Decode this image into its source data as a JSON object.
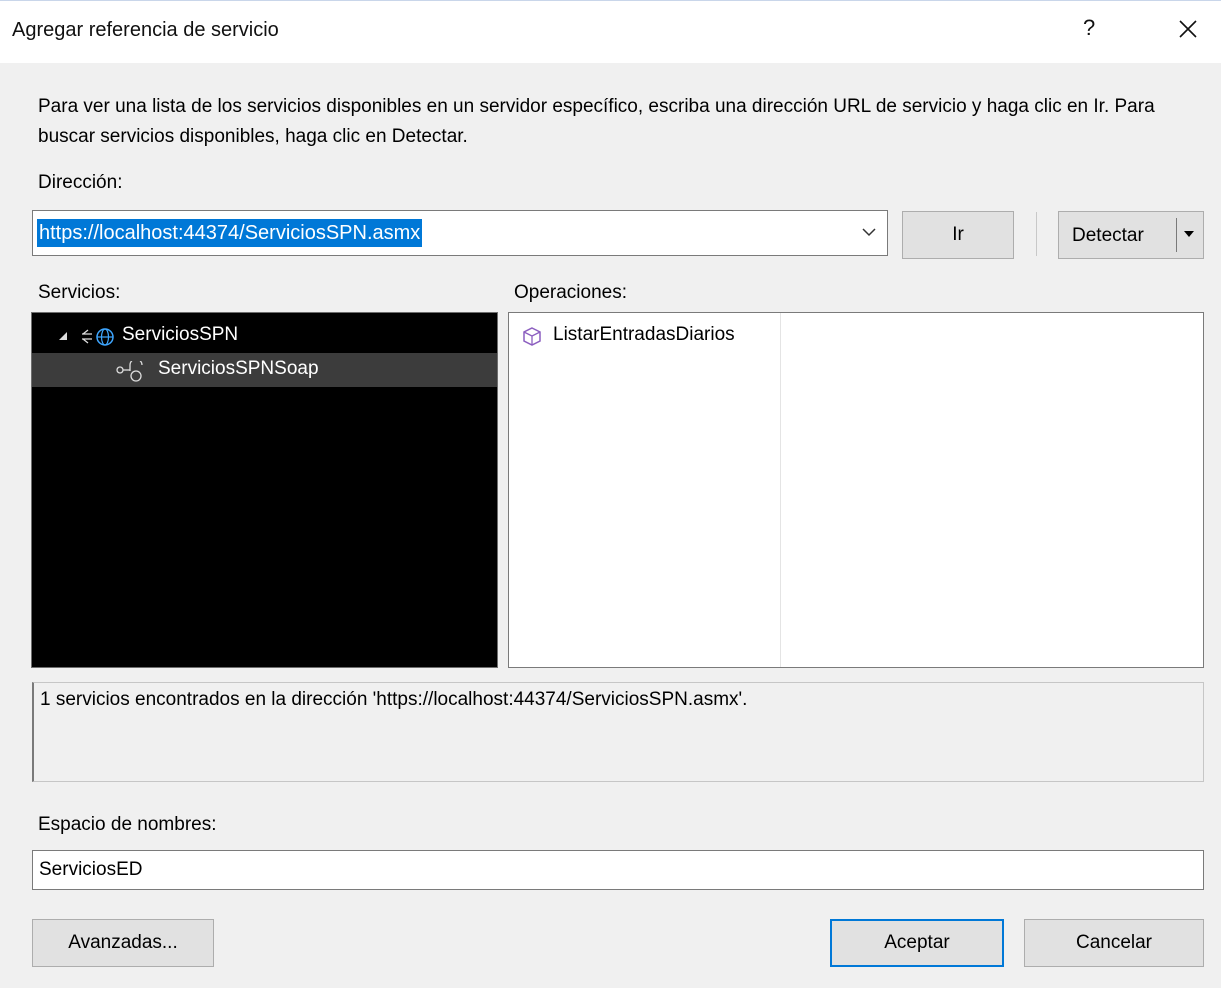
{
  "dialog": {
    "title": "Agregar referencia de servicio",
    "help_label": "?"
  },
  "description": "Para ver una lista de los servicios disponibles en un servidor específico, escriba una dirección URL de servicio y haga clic en Ir. Para buscar servicios disponibles, haga clic en Detectar.",
  "address": {
    "label": "Dirección:",
    "value": "https://localhost:44374/ServiciosSPN.asmx",
    "go_label": "Ir",
    "discover_label": "Detectar"
  },
  "services": {
    "label": "Servicios:",
    "items": [
      {
        "label": "ServiciosSPN",
        "icon": "web-service-icon",
        "expanded": true
      },
      {
        "label": "ServiciosSPNSoap",
        "icon": "endpoint-icon",
        "selected": true
      }
    ]
  },
  "operations": {
    "label": "Operaciones:",
    "items": [
      {
        "label": "ListarEntradasDiarios",
        "icon": "method-cube-icon"
      }
    ]
  },
  "status": {
    "text": "1 servicios encontrados en la dirección 'https://localhost:44374/ServiciosSPN.asmx'."
  },
  "namespace": {
    "label": "Espacio de nombres:",
    "value": "ServiciosED"
  },
  "footer": {
    "advanced_label": "Avanzadas...",
    "accept_label": "Aceptar",
    "cancel_label": "Cancelar"
  },
  "colors": {
    "accent": "#0078d7",
    "tree_background": "#000000",
    "tree_selected": "#3c3c3c",
    "dialog_background": "#f0f0f0"
  }
}
